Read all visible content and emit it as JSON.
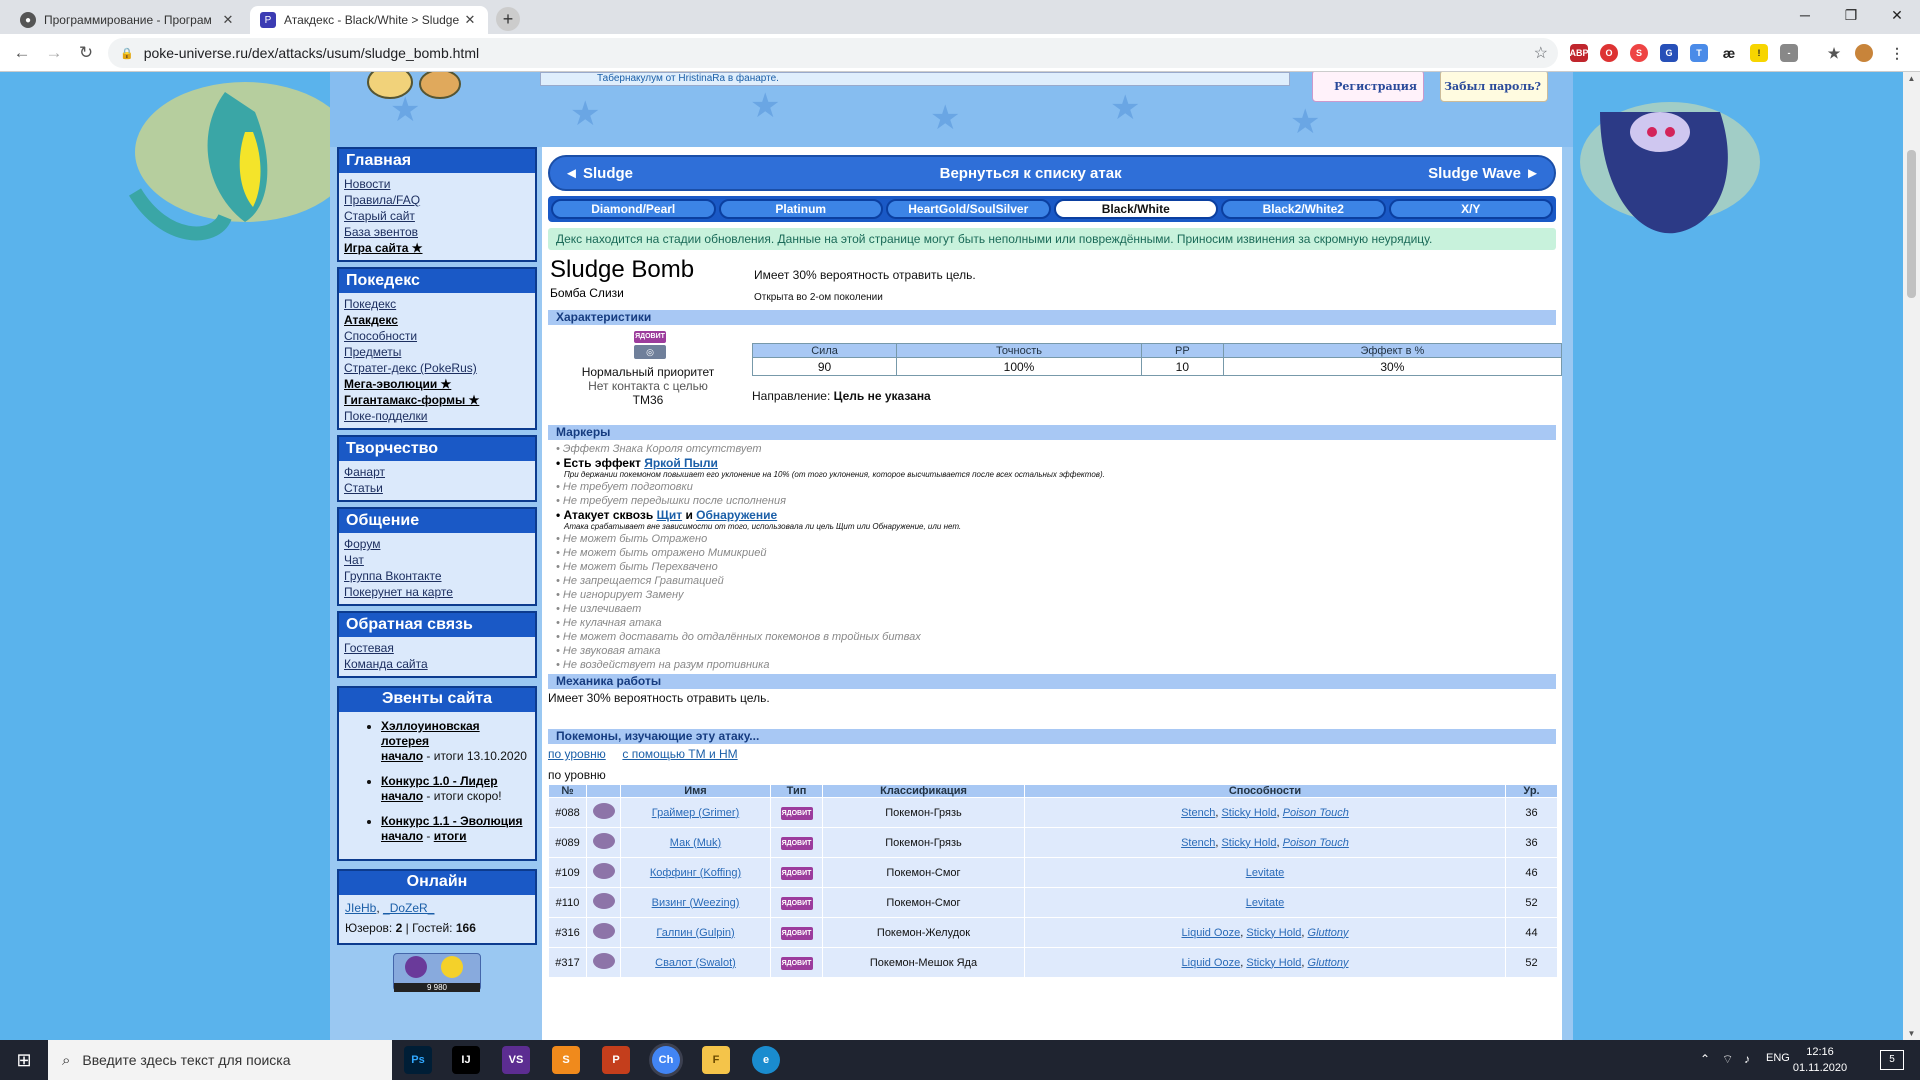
{
  "browser": {
    "tabs": [
      {
        "title": "Программирование - Програм"
      },
      {
        "title": "Атакдекс - Black/White > Sludge"
      }
    ],
    "new_tab_label": "+",
    "url": "poke-universe.ru/dex/attacks/usum/sludge_bomb.html",
    "extensions": [
      "ABP",
      "O",
      "S",
      "G",
      "T",
      "æ",
      "!",
      "-",
      "★"
    ]
  },
  "header": {
    "news_text": "Табернакулум от HristinaRa в фанарте.",
    "register_label": "Регистрация",
    "forgot_label": "Забыл пароль?"
  },
  "sidebar": {
    "main": {
      "title": "Главная",
      "items": [
        "Новости",
        "Правила/FAQ",
        "Старый сайт",
        "База эвентов",
        "Игра сайта ★"
      ]
    },
    "dex": {
      "title": "Покедекс",
      "items": [
        "Покедекс",
        "Атакдекс",
        "Способности",
        "Предметы",
        "Стратег-декс (PokeRus)",
        "Мега-эволюции ★",
        "Гигантамакс-формы ★",
        "Поке-подделки"
      ]
    },
    "creative": {
      "title": "Творчество",
      "items": [
        "Фанарт",
        "Статьи"
      ]
    },
    "community": {
      "title": "Общение",
      "items": [
        "Форум",
        "Чат",
        "Группа Вконтакте",
        "Покерунет на карте"
      ]
    },
    "feedback": {
      "title": "Обратная связь",
      "items": [
        "Гостевая",
        "Команда сайта"
      ]
    },
    "events": {
      "title": "Эвенты сайта",
      "items": [
        {
          "name": "Хэллоуиновская лотерея",
          "start": "начало",
          "sep": " - ",
          "result": "итоги 13.10.2020"
        },
        {
          "name": "Конкурс 1.0 - Лидер",
          "start": "начало",
          "sep": " - ",
          "result": "итоги скоро!"
        },
        {
          "name": "Конкурс 1.1 - Эволюция",
          "start": "начало",
          "sep": " - ",
          "result": "итоги"
        }
      ]
    },
    "online": {
      "title": "Онлайн",
      "users": [
        "JIeHb",
        "_DoZeR_"
      ],
      "users_label": "Юзеров:",
      "users_count": "2",
      "guests_label": "Гостей:",
      "guests_count": "166",
      "separator": " | "
    },
    "counter": "9 980"
  },
  "nav": {
    "prev": "◄ Sludge",
    "center": "Вернуться к списку атак",
    "next": "Sludge Wave ►"
  },
  "generations": [
    "Diamond/Pearl",
    "Platinum",
    "HeartGold/SoulSilver",
    "Black/White",
    "Black2/White2",
    "X/Y"
  ],
  "active_generation": "Black/White",
  "notice": "Декс находится на стадии обновления. Данные на этой странице могут быть неполными или повреждёнными. Приносим извинения за скромную неурядицу.",
  "move": {
    "name": "Sludge Bomb",
    "name_ru": "Бомба Слизи",
    "description": "Имеет 30% вероятность отравить цель.",
    "introduced": "Открыта во 2-ом поколении",
    "type_badge": "ЯДОВИТ",
    "priority": "Нормальный приоритет",
    "contact": "Нет контакта с целью",
    "tm": "TM36",
    "stats_headers": [
      "Сила",
      "Точность",
      "PP",
      "Эффект в %"
    ],
    "stats_values": [
      "90",
      "100%",
      "10",
      "30%"
    ],
    "direction_label": "Направление:",
    "direction_value": "Цель не указана"
  },
  "sections": {
    "characteristics": "Характеристики",
    "markers": "Маркеры",
    "mechanics": "Механика работы",
    "learners": "Покемоны, изучающие эту атаку..."
  },
  "markers": [
    {
      "text": "Эффект Знака Короля отсутствует",
      "enabled": false
    },
    {
      "text": "Есть эффект",
      "link": "Яркой Пыли",
      "enabled": true,
      "note": "При держании покемоном повышает его уклонение на 10% (от того уклонения, которое высчитывается после всех остальных эффектов)."
    },
    {
      "text": "Не требует подготовки",
      "enabled": false
    },
    {
      "text": "Не требует передышки после исполнения",
      "enabled": false
    },
    {
      "text": "Атакует сквозь",
      "link": "Щит",
      "and": "и",
      "link2": "Обнаружение",
      "enabled": true,
      "note": "Атака срабатывает вне зависимости от того, использовала ли цель Щит или Обнаружение, или нет."
    },
    {
      "text": "Не может быть Отражено",
      "enabled": false
    },
    {
      "text": "Не может быть отражено Мимикрией",
      "enabled": false
    },
    {
      "text": "Не может быть Перехвачено",
      "enabled": false
    },
    {
      "text": "Не запрещается Гравитацией",
      "enabled": false
    },
    {
      "text": "Не игнорирует Замену",
      "enabled": false
    },
    {
      "text": "Не излечивает",
      "enabled": false
    },
    {
      "text": "Не кулачная атака",
      "enabled": false
    },
    {
      "text": "Не может доставать до отдалённых покемонов в тройных битвах",
      "enabled": false
    },
    {
      "text": "Не звуковая атака",
      "enabled": false
    },
    {
      "text": "Не воздействует на разум противника",
      "enabled": false
    }
  ],
  "mechanics_text": "Имеет 30% вероятность отравить цель.",
  "learn_links": [
    "по уровню",
    "с помощью ТМ и НМ"
  ],
  "learn_subtitle": "по уровню",
  "pokemon_table": {
    "headers": [
      "№",
      "",
      "Имя",
      "Тип",
      "Классификация",
      "Способности",
      "Ур."
    ],
    "type_badge": "ЯДОВИТ",
    "rows": [
      {
        "num": "#088",
        "name": "Граймер (Grimer)",
        "class": "Покемон-Грязь",
        "abilities": [
          "Stench",
          "Sticky Hold",
          "Poison Touch"
        ],
        "lvl": "36"
      },
      {
        "num": "#089",
        "name": "Мак (Muk)",
        "class": "Покемон-Грязь",
        "abilities": [
          "Stench",
          "Sticky Hold",
          "Poison Touch"
        ],
        "lvl": "36"
      },
      {
        "num": "#109",
        "name": "Коффинг (Koffing)",
        "class": "Покемон-Смог",
        "abilities": [
          "Levitate"
        ],
        "lvl": "46"
      },
      {
        "num": "#110",
        "name": "Визинг (Weezing)",
        "class": "Покемон-Смог",
        "abilities": [
          "Levitate"
        ],
        "lvl": "52"
      },
      {
        "num": "#316",
        "name": "Галпин (Gulpin)",
        "class": "Покемон-Желудок",
        "abilities": [
          "Liquid Ooze",
          "Sticky Hold",
          "Gluttony"
        ],
        "lvl": "44"
      },
      {
        "num": "#317",
        "name": "Свалот (Swalot)",
        "class": "Покемон-Мешок Яда",
        "abilities": [
          "Liquid Ooze",
          "Sticky Hold",
          "Gluttony"
        ],
        "lvl": "52"
      }
    ]
  },
  "taskbar": {
    "search_placeholder": "Введите здесь текст для поиска",
    "apps": [
      "Ps",
      "IJ",
      "VS",
      "S",
      "P",
      "Ch",
      "F",
      "e"
    ],
    "lang": "ENG",
    "time": "12:16",
    "date": "01.11.2020",
    "notifications": "5"
  },
  "colors": {
    "accent": "#1a59c6",
    "page_bg": "#5ab3ec",
    "notice_bg": "#c8f2dc",
    "poison": "#9c3c9c"
  }
}
